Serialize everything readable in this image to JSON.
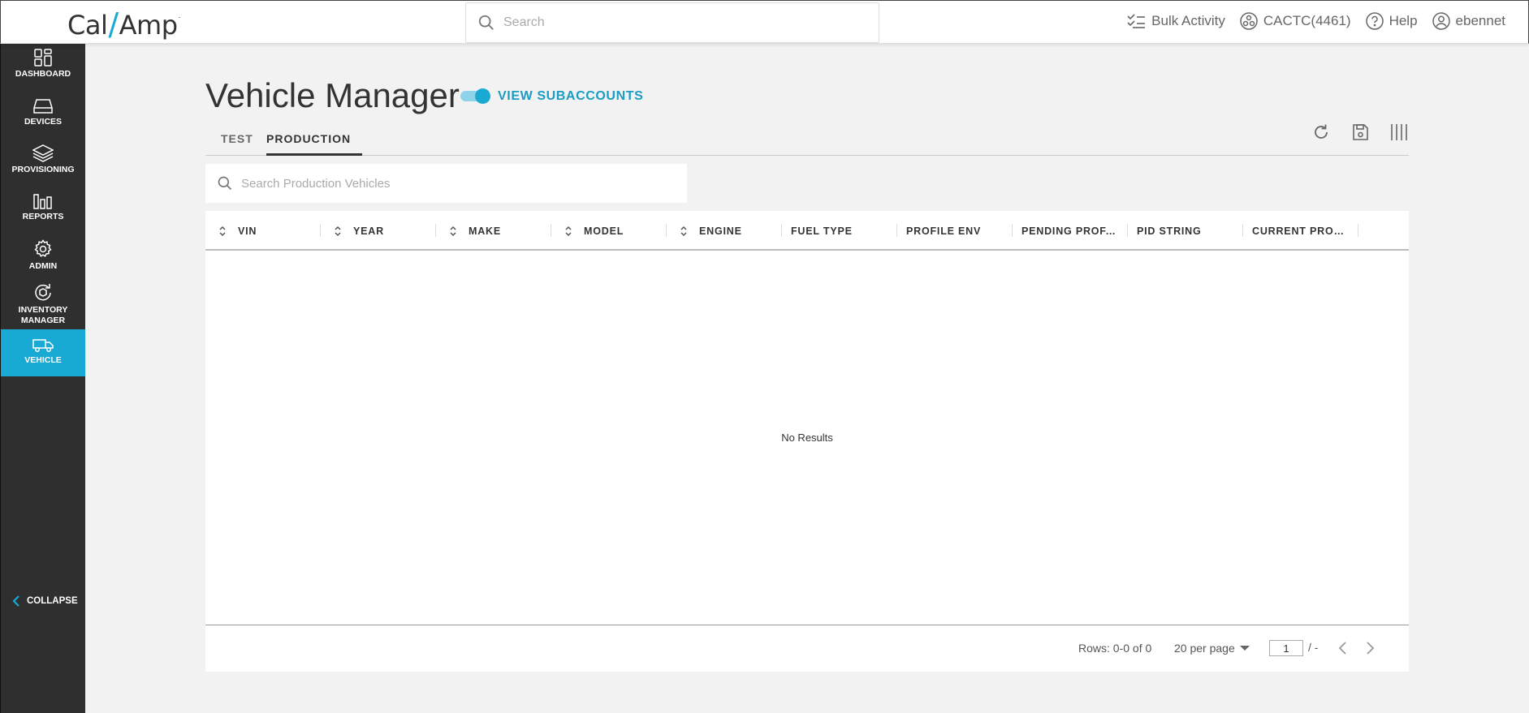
{
  "header": {
    "logo_left": "Cal",
    "logo_slash": "/",
    "logo_right": "Amp",
    "logo_mark": ".",
    "search_placeholder": "Search",
    "bulk_activity": "Bulk Activity",
    "account": "CACTC(4461)",
    "help": "Help",
    "user": "ebennet"
  },
  "sidebar": {
    "items": [
      {
        "label": "DASHBOARD",
        "icon": "dashboard-icon"
      },
      {
        "label": "DEVICES",
        "icon": "device-icon"
      },
      {
        "label": "PROVISIONING",
        "icon": "layers-icon"
      },
      {
        "label": "REPORTS",
        "icon": "bar-chart-icon"
      },
      {
        "label": "ADMIN",
        "icon": "gear-icon"
      },
      {
        "label_line1": "INVENTORY",
        "label_line2": "MANAGER",
        "icon": "inventory-icon"
      },
      {
        "label": "VEHICLE",
        "icon": "truck-icon",
        "active": true
      }
    ],
    "collapse": "COLLAPSE"
  },
  "page": {
    "title": "Vehicle Manager",
    "toggle_label": "VIEW SUBACCOUNTS",
    "toggle_on": true
  },
  "tabs": [
    "TEST",
    "PRODUCTION"
  ],
  "active_tab": "PRODUCTION",
  "table_search_placeholder": "Search Production Vehicles",
  "columns": [
    {
      "label": "VIN",
      "sortable": true
    },
    {
      "label": "YEAR",
      "sortable": true
    },
    {
      "label": "MAKE",
      "sortable": true
    },
    {
      "label": "MODEL",
      "sortable": true
    },
    {
      "label": "ENGINE",
      "sortable": true
    },
    {
      "label": "FUEL TYPE",
      "sortable": false
    },
    {
      "label": "PROFILE ENV",
      "sortable": false
    },
    {
      "label": "PENDING PROF. V...",
      "sortable": false
    },
    {
      "label": "PID STRING",
      "sortable": false
    },
    {
      "label": "CURRENT PROF. ...",
      "sortable": false
    }
  ],
  "empty_message": "No Results",
  "footer": {
    "rows_info": "Rows: 0-0 of 0",
    "per_page": "20 per page",
    "page_value": "1",
    "page_sep": "/ -"
  },
  "colors": {
    "accent": "#1aa9d3",
    "sidebar_bg": "#2f2f2f",
    "active_nav": "#18a9d4"
  }
}
